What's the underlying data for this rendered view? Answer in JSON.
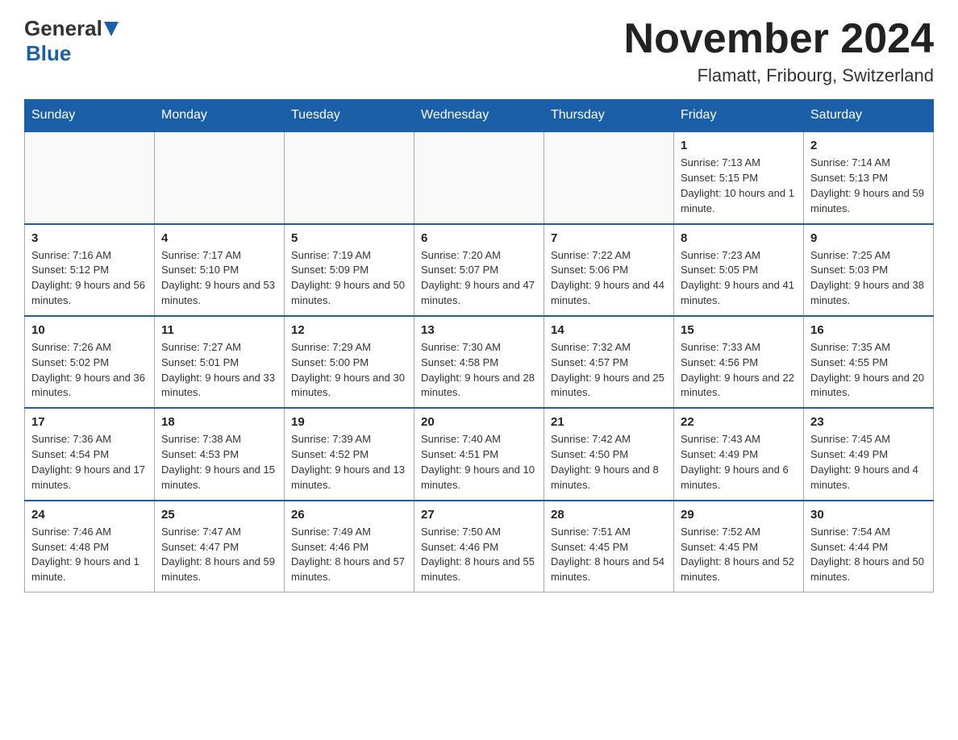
{
  "logo": {
    "general": "General",
    "blue": "Blue"
  },
  "title": {
    "month_year": "November 2024",
    "location": "Flamatt, Fribourg, Switzerland"
  },
  "headers": [
    "Sunday",
    "Monday",
    "Tuesday",
    "Wednesday",
    "Thursday",
    "Friday",
    "Saturday"
  ],
  "weeks": [
    [
      {
        "day": "",
        "info": ""
      },
      {
        "day": "",
        "info": ""
      },
      {
        "day": "",
        "info": ""
      },
      {
        "day": "",
        "info": ""
      },
      {
        "day": "",
        "info": ""
      },
      {
        "day": "1",
        "info": "Sunrise: 7:13 AM\nSunset: 5:15 PM\nDaylight: 10 hours and 1 minute."
      },
      {
        "day": "2",
        "info": "Sunrise: 7:14 AM\nSunset: 5:13 PM\nDaylight: 9 hours and 59 minutes."
      }
    ],
    [
      {
        "day": "3",
        "info": "Sunrise: 7:16 AM\nSunset: 5:12 PM\nDaylight: 9 hours and 56 minutes."
      },
      {
        "day": "4",
        "info": "Sunrise: 7:17 AM\nSunset: 5:10 PM\nDaylight: 9 hours and 53 minutes."
      },
      {
        "day": "5",
        "info": "Sunrise: 7:19 AM\nSunset: 5:09 PM\nDaylight: 9 hours and 50 minutes."
      },
      {
        "day": "6",
        "info": "Sunrise: 7:20 AM\nSunset: 5:07 PM\nDaylight: 9 hours and 47 minutes."
      },
      {
        "day": "7",
        "info": "Sunrise: 7:22 AM\nSunset: 5:06 PM\nDaylight: 9 hours and 44 minutes."
      },
      {
        "day": "8",
        "info": "Sunrise: 7:23 AM\nSunset: 5:05 PM\nDaylight: 9 hours and 41 minutes."
      },
      {
        "day": "9",
        "info": "Sunrise: 7:25 AM\nSunset: 5:03 PM\nDaylight: 9 hours and 38 minutes."
      }
    ],
    [
      {
        "day": "10",
        "info": "Sunrise: 7:26 AM\nSunset: 5:02 PM\nDaylight: 9 hours and 36 minutes."
      },
      {
        "day": "11",
        "info": "Sunrise: 7:27 AM\nSunset: 5:01 PM\nDaylight: 9 hours and 33 minutes."
      },
      {
        "day": "12",
        "info": "Sunrise: 7:29 AM\nSunset: 5:00 PM\nDaylight: 9 hours and 30 minutes."
      },
      {
        "day": "13",
        "info": "Sunrise: 7:30 AM\nSunset: 4:58 PM\nDaylight: 9 hours and 28 minutes."
      },
      {
        "day": "14",
        "info": "Sunrise: 7:32 AM\nSunset: 4:57 PM\nDaylight: 9 hours and 25 minutes."
      },
      {
        "day": "15",
        "info": "Sunrise: 7:33 AM\nSunset: 4:56 PM\nDaylight: 9 hours and 22 minutes."
      },
      {
        "day": "16",
        "info": "Sunrise: 7:35 AM\nSunset: 4:55 PM\nDaylight: 9 hours and 20 minutes."
      }
    ],
    [
      {
        "day": "17",
        "info": "Sunrise: 7:36 AM\nSunset: 4:54 PM\nDaylight: 9 hours and 17 minutes."
      },
      {
        "day": "18",
        "info": "Sunrise: 7:38 AM\nSunset: 4:53 PM\nDaylight: 9 hours and 15 minutes."
      },
      {
        "day": "19",
        "info": "Sunrise: 7:39 AM\nSunset: 4:52 PM\nDaylight: 9 hours and 13 minutes."
      },
      {
        "day": "20",
        "info": "Sunrise: 7:40 AM\nSunset: 4:51 PM\nDaylight: 9 hours and 10 minutes."
      },
      {
        "day": "21",
        "info": "Sunrise: 7:42 AM\nSunset: 4:50 PM\nDaylight: 9 hours and 8 minutes."
      },
      {
        "day": "22",
        "info": "Sunrise: 7:43 AM\nSunset: 4:49 PM\nDaylight: 9 hours and 6 minutes."
      },
      {
        "day": "23",
        "info": "Sunrise: 7:45 AM\nSunset: 4:49 PM\nDaylight: 9 hours and 4 minutes."
      }
    ],
    [
      {
        "day": "24",
        "info": "Sunrise: 7:46 AM\nSunset: 4:48 PM\nDaylight: 9 hours and 1 minute."
      },
      {
        "day": "25",
        "info": "Sunrise: 7:47 AM\nSunset: 4:47 PM\nDaylight: 8 hours and 59 minutes."
      },
      {
        "day": "26",
        "info": "Sunrise: 7:49 AM\nSunset: 4:46 PM\nDaylight: 8 hours and 57 minutes."
      },
      {
        "day": "27",
        "info": "Sunrise: 7:50 AM\nSunset: 4:46 PM\nDaylight: 8 hours and 55 minutes."
      },
      {
        "day": "28",
        "info": "Sunrise: 7:51 AM\nSunset: 4:45 PM\nDaylight: 8 hours and 54 minutes."
      },
      {
        "day": "29",
        "info": "Sunrise: 7:52 AM\nSunset: 4:45 PM\nDaylight: 8 hours and 52 minutes."
      },
      {
        "day": "30",
        "info": "Sunrise: 7:54 AM\nSunset: 4:44 PM\nDaylight: 8 hours and 50 minutes."
      }
    ]
  ]
}
